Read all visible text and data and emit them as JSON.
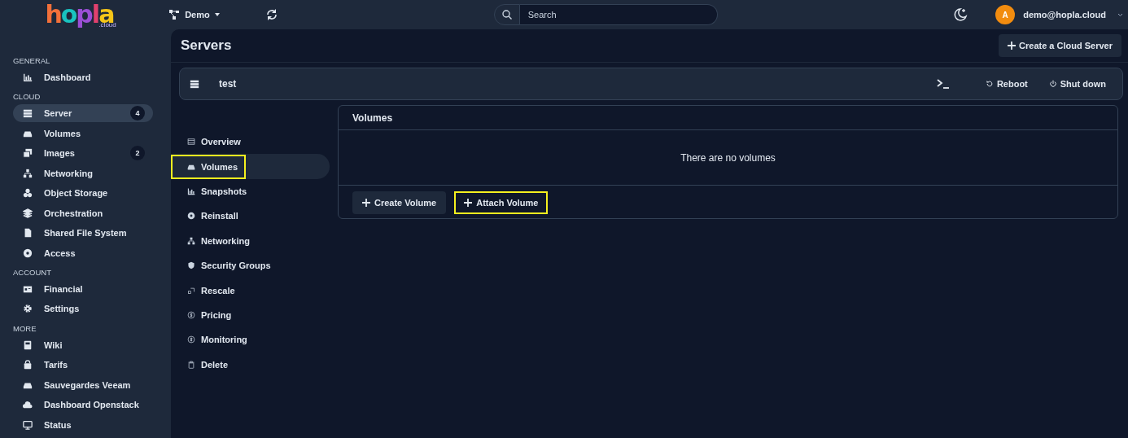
{
  "topbar": {
    "logo": {
      "letters": [
        {
          "text": "h",
          "color": "#f2703a"
        },
        {
          "text": "o",
          "color": "#19c3c0"
        },
        {
          "text": "p",
          "color": "#9b4fd6"
        },
        {
          "text": "l",
          "color": "#e2406e"
        },
        {
          "text": "a",
          "color": "#f5c518"
        }
      ],
      "suffix": ".cloud"
    },
    "project": {
      "label": "Demo"
    },
    "search": {
      "placeholder": "Search"
    },
    "user": {
      "initial": "A",
      "email": "demo@hopla.cloud"
    }
  },
  "sidebar": {
    "sections": [
      {
        "heading": "GENERAL",
        "items": [
          {
            "label": "Dashboard",
            "selected": false
          }
        ]
      },
      {
        "heading": "CLOUD",
        "items": [
          {
            "label": "Server",
            "selected": true,
            "badge": "4"
          },
          {
            "label": "Volumes",
            "selected": false
          },
          {
            "label": "Images",
            "selected": false,
            "badge": "2"
          },
          {
            "label": "Networking",
            "selected": false
          },
          {
            "label": "Object Storage",
            "selected": false
          },
          {
            "label": "Orchestration",
            "selected": false
          },
          {
            "label": "Shared File System",
            "selected": false
          },
          {
            "label": "Access",
            "selected": false
          }
        ]
      },
      {
        "heading": "ACCOUNT",
        "items": [
          {
            "label": "Financial",
            "selected": false
          },
          {
            "label": "Settings",
            "selected": false
          }
        ]
      },
      {
        "heading": "MORE",
        "items": [
          {
            "label": "Wiki",
            "selected": false
          },
          {
            "label": "Tarifs",
            "selected": false
          },
          {
            "label": "Sauvegardes Veeam",
            "selected": false
          },
          {
            "label": "Dashboard Openstack",
            "selected": false
          },
          {
            "label": "Status",
            "selected": false
          }
        ]
      }
    ]
  },
  "page": {
    "title": "Servers",
    "create_button": "Create a Cloud Server"
  },
  "server": {
    "name": "test",
    "actions": [
      {
        "label": "Reboot"
      },
      {
        "label": "Shut down"
      }
    ]
  },
  "subnav": [
    {
      "label": "Overview",
      "selected": false,
      "highlighted": false
    },
    {
      "label": "Volumes",
      "selected": true,
      "highlighted": true
    },
    {
      "label": "Snapshots",
      "selected": false,
      "highlighted": false
    },
    {
      "label": "Reinstall",
      "selected": false,
      "highlighted": false
    },
    {
      "label": "Networking",
      "selected": false,
      "highlighted": false
    },
    {
      "label": "Security Groups",
      "selected": false,
      "highlighted": false
    },
    {
      "label": "Rescale",
      "selected": false,
      "highlighted": false
    },
    {
      "label": "Pricing",
      "selected": false,
      "highlighted": false
    },
    {
      "label": "Monitoring",
      "selected": false,
      "highlighted": false
    },
    {
      "label": "Delete",
      "selected": false,
      "highlighted": false
    }
  ],
  "panel": {
    "title": "Volumes",
    "empty_text": "There are no volumes",
    "buttons": [
      {
        "label": "Create Volume",
        "highlighted": false
      },
      {
        "label": "Attach Volume",
        "highlighted": true
      }
    ]
  }
}
